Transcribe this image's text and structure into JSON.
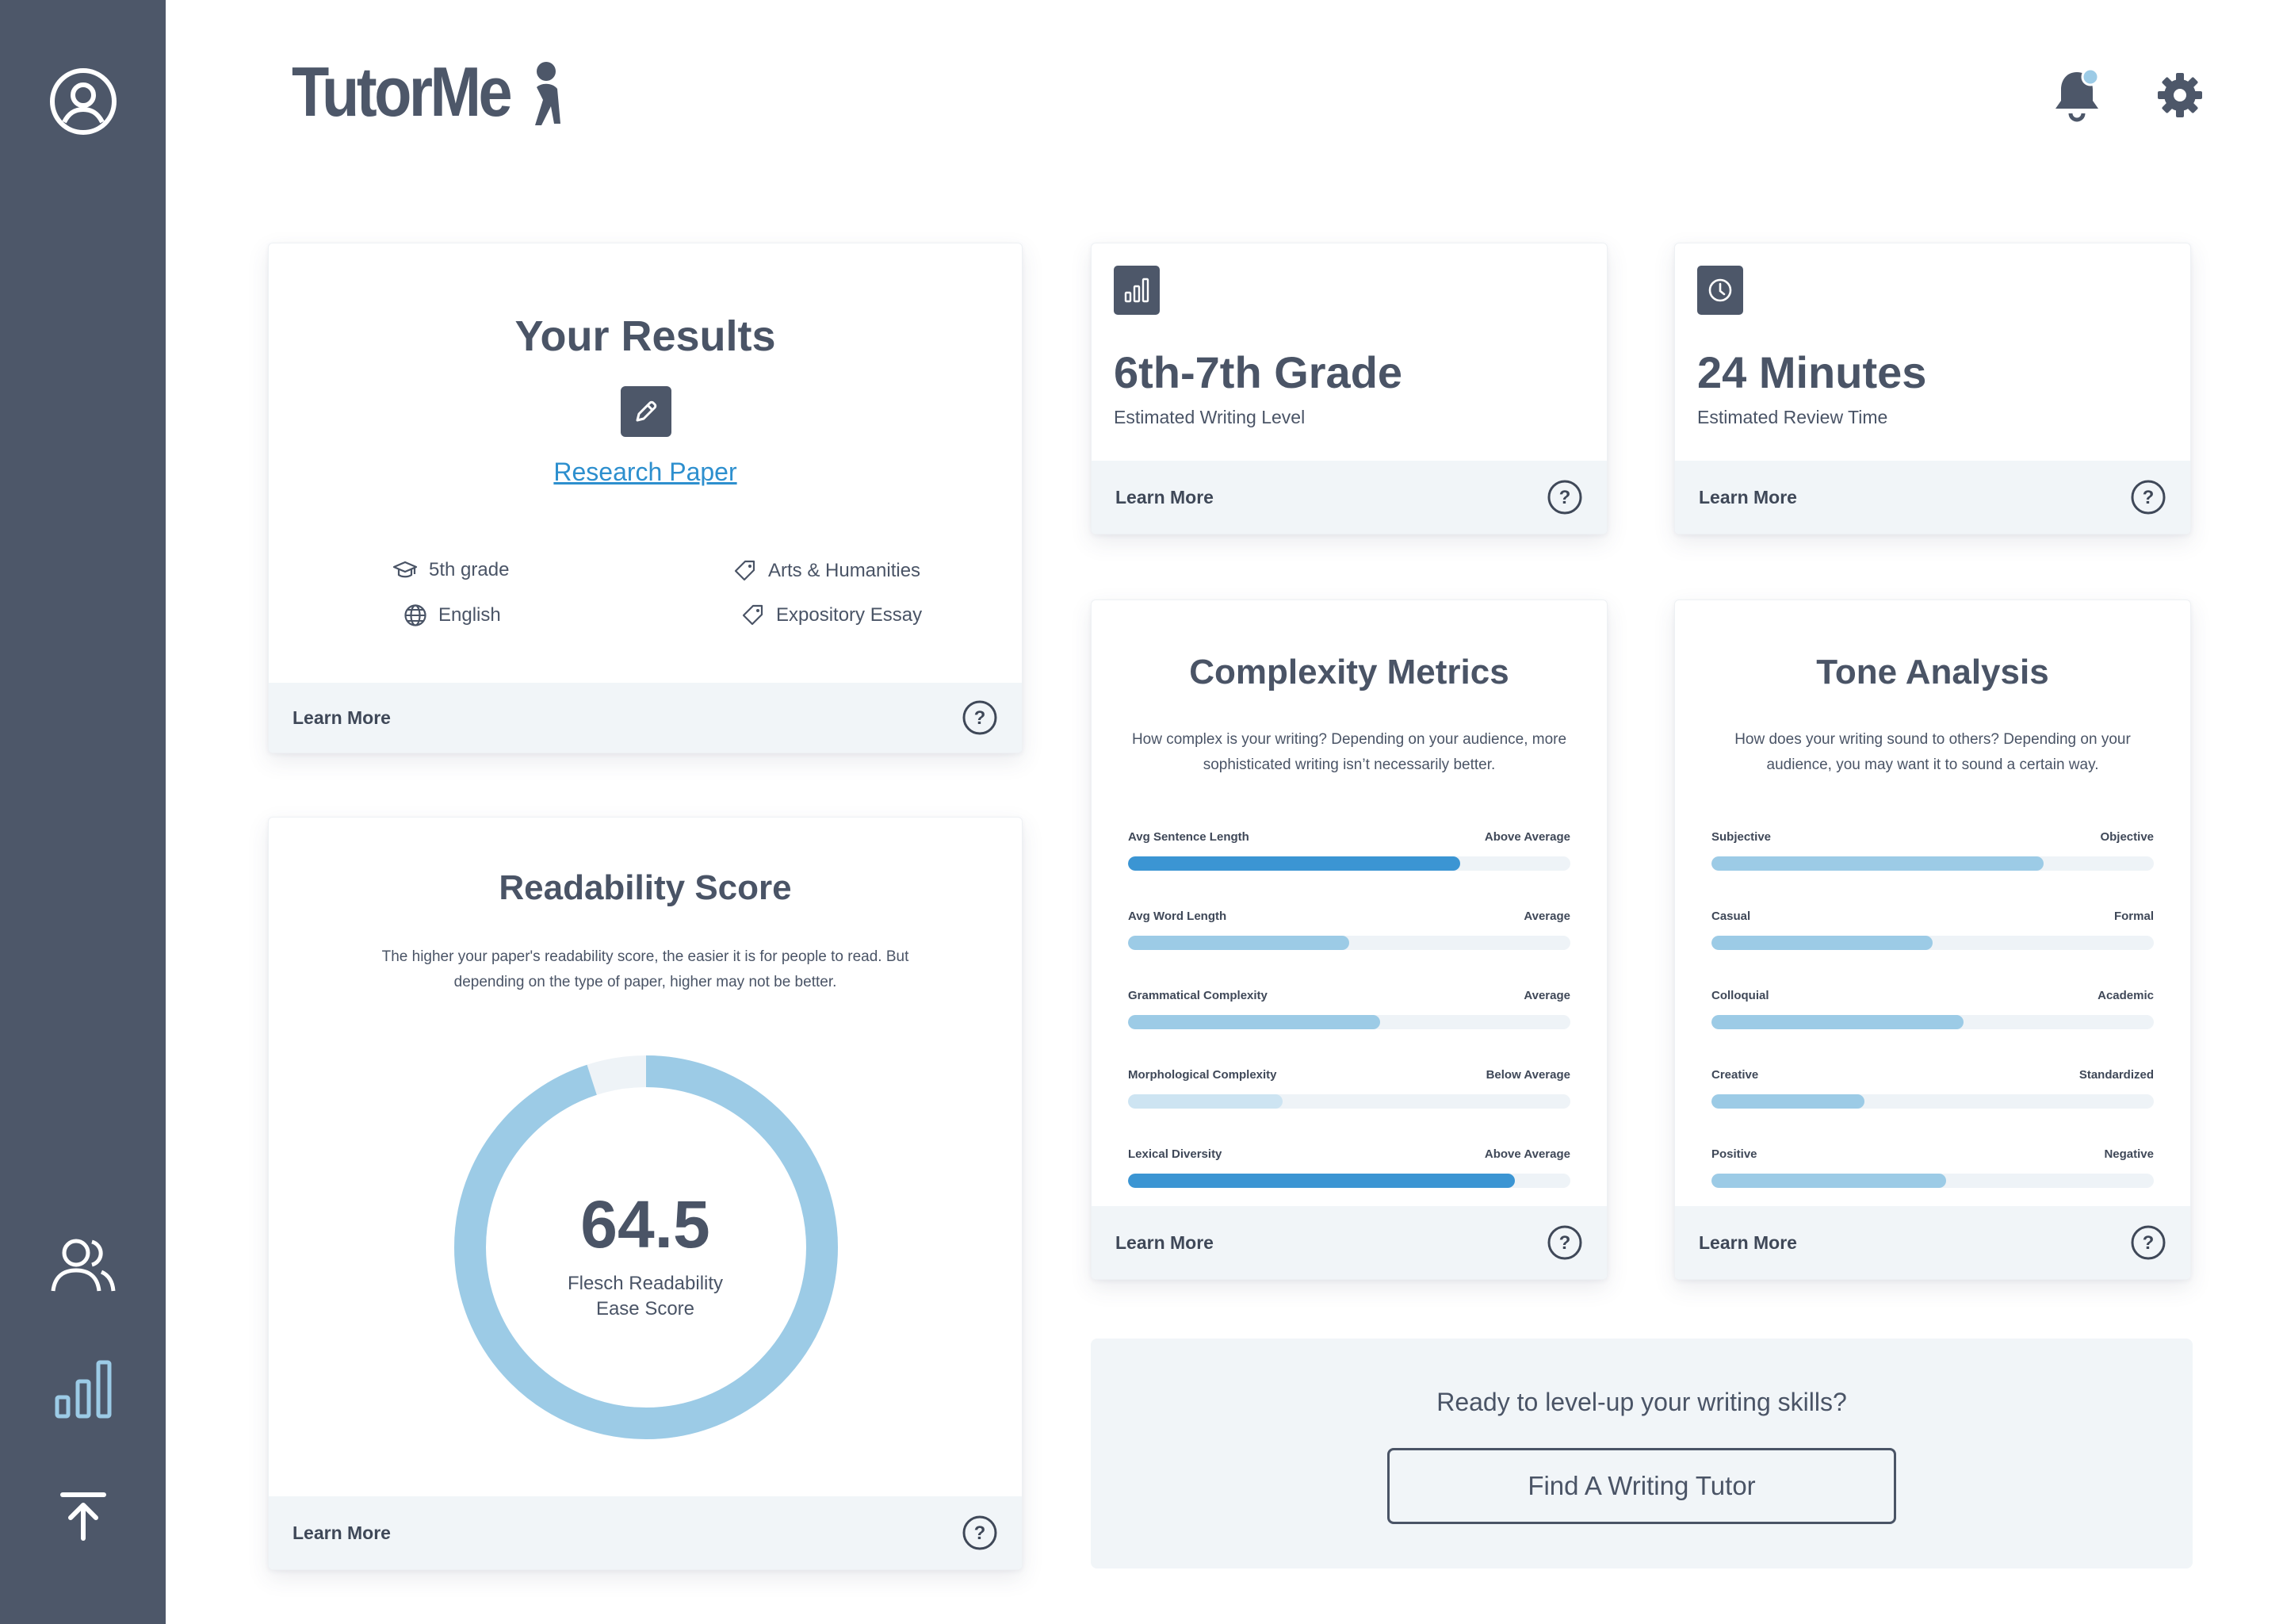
{
  "brand": {
    "name": "TutorMe"
  },
  "sidebar": {
    "items": [
      {
        "icon": "user-circle-icon"
      },
      {
        "icon": "users-icon"
      },
      {
        "icon": "bar-chart-icon",
        "active": true
      },
      {
        "icon": "upload-icon"
      }
    ]
  },
  "header": {
    "notification_icon": "bell-icon",
    "settings_icon": "gear-icon"
  },
  "results": {
    "title": "Your Results",
    "paper_link": "Research Paper",
    "grade": "5th grade",
    "language": "English",
    "subject": "Arts & Humanities",
    "type": "Expository Essay",
    "learn_more": "Learn More"
  },
  "writing_level": {
    "value": "6th-7th Grade",
    "label": "Estimated Writing Level",
    "learn_more": "Learn More"
  },
  "review_time": {
    "value": "24 Minutes",
    "label": "Estimated Review Time",
    "learn_more": "Learn More"
  },
  "readability": {
    "title": "Readability Score",
    "description": "The higher your paper's readability score, the easier it is for people to read. But depending on the type of paper, higher may not be better.",
    "score": "64.5",
    "score_fraction": 0.95,
    "score_label": "Flesch Readability Ease Score",
    "learn_more": "Learn More"
  },
  "complexity": {
    "title": "Complexity Metrics",
    "description": "How complex is your writing? Depending on your audience, more sophisticated writing isn’t necessarily better.",
    "metrics": [
      {
        "label": "Avg Sentence Length",
        "rating": "Above Average",
        "level": 0.75
      },
      {
        "label": "Avg Word Length",
        "rating": "Average",
        "level": 0.5
      },
      {
        "label": "Grammatical Complexity",
        "rating": "Average",
        "level": 0.57
      },
      {
        "label": "Morphological Complexity",
        "rating": "Below Average",
        "level": 0.35
      },
      {
        "label": "Lexical Diversity",
        "rating": "Above Average",
        "level": 0.875
      }
    ],
    "learn_more": "Learn More"
  },
  "tone": {
    "title": "Tone Analysis",
    "description": "How does your writing sound to others? Depending on your audience, you may want it to sound a certain way.",
    "metrics": [
      {
        "left": "Subjective",
        "right": "Objective",
        "level": 0.75
      },
      {
        "left": "Casual",
        "right": "Formal",
        "level": 0.5
      },
      {
        "left": "Colloquial",
        "right": "Academic",
        "level": 0.57
      },
      {
        "left": "Creative",
        "right": "Standardized",
        "level": 0.345
      },
      {
        "left": "Positive",
        "right": "Negative",
        "level": 0.53
      }
    ],
    "learn_more": "Learn More"
  },
  "cta": {
    "prompt": "Ready to level-up your writing skills?",
    "button": "Find A Writing Tutor"
  },
  "colors": {
    "sidebar": "#4d5769",
    "accent_dark": "#3b95d3",
    "accent_light": "#9ccbe6",
    "accent_faint": "#cde4f2",
    "track": "#eef3f7",
    "link": "#2d8fce"
  }
}
